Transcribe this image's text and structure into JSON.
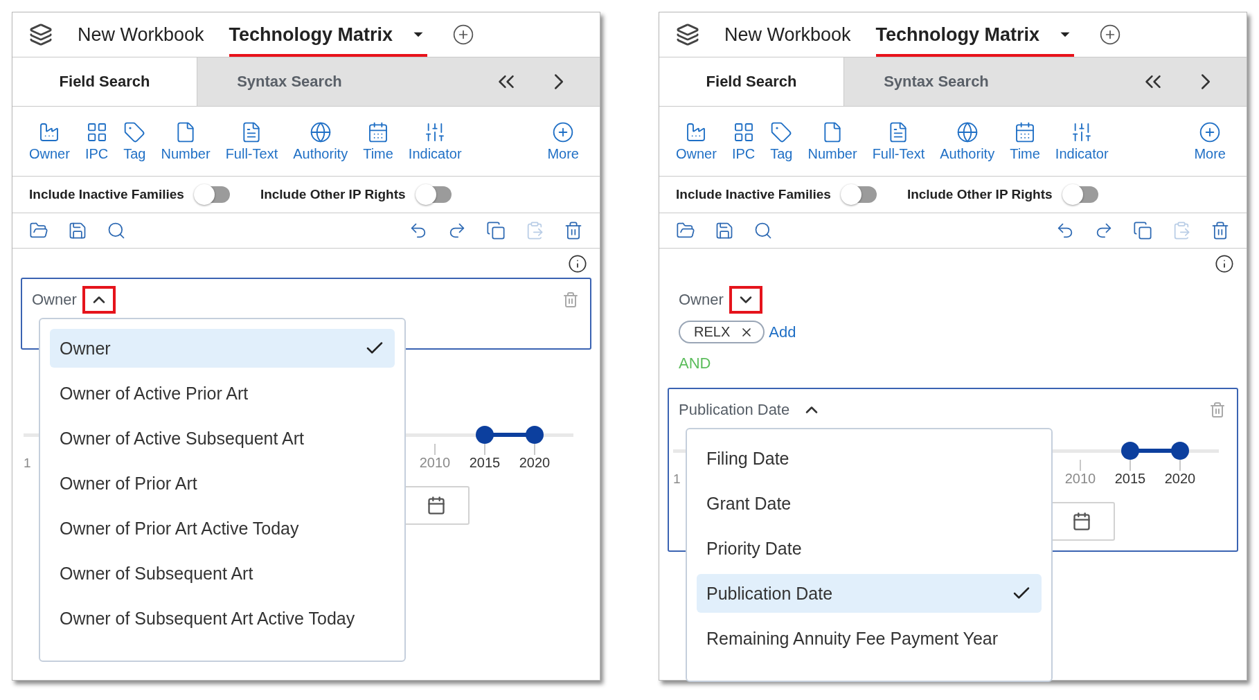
{
  "panels": [
    {
      "workbook_tabs": [
        {
          "label": "New Workbook",
          "selected": false
        },
        {
          "label": "Technology Matrix",
          "selected": true
        }
      ],
      "search_tabs": [
        {
          "label": "Field Search",
          "selected": true
        },
        {
          "label": "Syntax Search",
          "selected": false
        }
      ],
      "tools": [
        {
          "kind": "owner",
          "label": "Owner"
        },
        {
          "kind": "ipc",
          "label": "IPC"
        },
        {
          "kind": "tag",
          "label": "Tag"
        },
        {
          "kind": "number",
          "label": "Number"
        },
        {
          "kind": "fulltext",
          "label": "Full-Text"
        },
        {
          "kind": "authority",
          "label": "Authority"
        },
        {
          "kind": "time",
          "label": "Time"
        },
        {
          "kind": "indicator",
          "label": "Indicator"
        },
        {
          "kind": "more",
          "label": "More"
        }
      ],
      "toggles": [
        {
          "label": "Include Inactive Families",
          "on": false
        },
        {
          "label": "Include Other IP Rights",
          "on": false
        }
      ],
      "actions": [
        {
          "kind": "open",
          "disabled": false
        },
        {
          "kind": "save",
          "disabled": false
        },
        {
          "kind": "history",
          "disabled": false
        },
        {
          "kind": "undo",
          "disabled": false
        },
        {
          "kind": "redo",
          "disabled": false
        },
        {
          "kind": "copy",
          "disabled": false
        },
        {
          "kind": "paste",
          "disabled": true
        },
        {
          "kind": "delete",
          "disabled": false
        }
      ],
      "criteria": [
        {
          "label": "Owner",
          "boxed": true,
          "expanded": true,
          "highlighted": true,
          "menu": [
            {
              "label": "Owner",
              "selected": true
            },
            {
              "label": "Owner of Active Prior Art",
              "selected": false
            },
            {
              "label": "Owner of Active Subsequent Art",
              "selected": false
            },
            {
              "label": "Owner of Prior Art",
              "selected": false
            },
            {
              "label": "Owner of Prior Art Active Today",
              "selected": false
            },
            {
              "label": "Owner of Subsequent Art",
              "selected": false
            },
            {
              "label": "Owner of Subsequent Art Active Today",
              "selected": false
            }
          ]
        }
      ],
      "range": {
        "edge_label": "1",
        "ticks": [
          {
            "label": "2010",
            "selected": false
          },
          {
            "label": "2015",
            "selected": true
          },
          {
            "label": "2020",
            "selected": true
          }
        ]
      }
    },
    {
      "workbook_tabs": [
        {
          "label": "New Workbook",
          "selected": false
        },
        {
          "label": "Technology Matrix",
          "selected": true
        }
      ],
      "search_tabs": [
        {
          "label": "Field Search",
          "selected": true
        },
        {
          "label": "Syntax Search",
          "selected": false
        }
      ],
      "tools": [
        {
          "kind": "owner",
          "label": "Owner"
        },
        {
          "kind": "ipc",
          "label": "IPC"
        },
        {
          "kind": "tag",
          "label": "Tag"
        },
        {
          "kind": "number",
          "label": "Number"
        },
        {
          "kind": "fulltext",
          "label": "Full-Text"
        },
        {
          "kind": "authority",
          "label": "Authority"
        },
        {
          "kind": "time",
          "label": "Time"
        },
        {
          "kind": "indicator",
          "label": "Indicator"
        },
        {
          "kind": "more",
          "label": "More"
        }
      ],
      "toggles": [
        {
          "label": "Include Inactive Families",
          "on": false
        },
        {
          "label": "Include Other IP Rights",
          "on": false
        }
      ],
      "actions": [
        {
          "kind": "open",
          "disabled": false
        },
        {
          "kind": "save",
          "disabled": false
        },
        {
          "kind": "history",
          "disabled": false
        },
        {
          "kind": "undo",
          "disabled": false
        },
        {
          "kind": "redo",
          "disabled": false
        },
        {
          "kind": "copy",
          "disabled": false
        },
        {
          "kind": "paste",
          "disabled": true
        },
        {
          "kind": "delete",
          "disabled": false
        }
      ],
      "criteria": [
        {
          "label": "Owner",
          "boxed": false,
          "expanded": false,
          "highlighted": true,
          "chips": [
            "RELX"
          ],
          "add_link": "Add",
          "operator": "AND"
        },
        {
          "label": "Publication Date",
          "boxed": true,
          "expanded": true,
          "highlighted": false,
          "range": {
            "edge_label": "1",
            "ticks": [
              {
                "label": "2010",
                "selected": false
              },
              {
                "label": "2015",
                "selected": true
              },
              {
                "label": "2020",
                "selected": true
              }
            ]
          },
          "menu": [
            {
              "label": "Filing Date",
              "selected": false
            },
            {
              "label": "Grant Date",
              "selected": false
            },
            {
              "label": "Priority Date",
              "selected": false
            },
            {
              "label": "Publication Date",
              "selected": true
            },
            {
              "label": "Remaining Annuity Fee Payment Year",
              "selected": false
            }
          ]
        }
      ]
    }
  ]
}
